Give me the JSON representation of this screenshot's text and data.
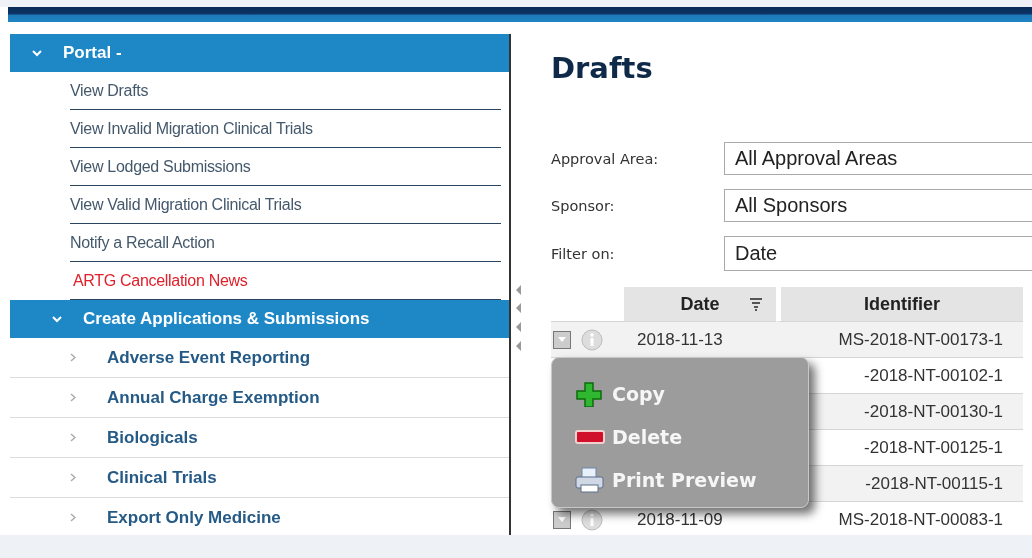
{
  "sidebar": {
    "sections": [
      {
        "title": "Portal -",
        "kind": "links",
        "expanded": true,
        "items": [
          {
            "label": "View Drafts",
            "kind": "link"
          },
          {
            "label": "View Invalid Migration Clinical Trials",
            "kind": "link"
          },
          {
            "label": "View Lodged Submissions",
            "kind": "link"
          },
          {
            "label": "View Valid Migration Clinical Trials",
            "kind": "link"
          },
          {
            "label": "Notify a Recall Action",
            "kind": "link"
          },
          {
            "label": "ARTG Cancellation News",
            "kind": "alert"
          }
        ]
      },
      {
        "title": "Create Applications & Submissions",
        "kind": "categories",
        "expanded": true,
        "items": [
          {
            "label": "Adverse Event Reporting",
            "expanded": false
          },
          {
            "label": "Annual Charge Exemption",
            "expanded": false
          },
          {
            "label": "Biologicals",
            "expanded": false
          },
          {
            "label": "Clinical Trials",
            "expanded": false
          },
          {
            "label": "Export Only Medicine",
            "expanded": false
          }
        ]
      }
    ]
  },
  "page": {
    "title": "Drafts",
    "filters": [
      {
        "label": "Approval Area:",
        "value": "All Approval Areas"
      },
      {
        "label": "Sponsor:",
        "value": "All Sponsors"
      },
      {
        "label": "Filter on:",
        "value": "Date"
      }
    ],
    "table": {
      "columns": [
        {
          "label": "Date",
          "filter": true
        },
        {
          "label": "Identifier",
          "filter": false
        }
      ],
      "rows": [
        {
          "date": "2018-11-13",
          "identifier": "MS-2018-NT-00173-1",
          "actions": true
        },
        {
          "identifier": "-2018-NT-00102-1",
          "actions": false
        },
        {
          "identifier": "-2018-NT-00130-1",
          "actions": false
        },
        {
          "identifier": "-2018-NT-00125-1",
          "actions": false
        },
        {
          "identifier": "-2018-NT-00115-1",
          "actions": false
        },
        {
          "date": "2018-11-09",
          "identifier": "MS-2018-NT-00083-1",
          "actions": true
        }
      ]
    },
    "context_menu": {
      "items": [
        {
          "label": "Copy",
          "kind": "copy"
        },
        {
          "label": "Delete",
          "kind": "delete"
        },
        {
          "label": "Print Preview",
          "kind": "print"
        }
      ]
    }
  }
}
